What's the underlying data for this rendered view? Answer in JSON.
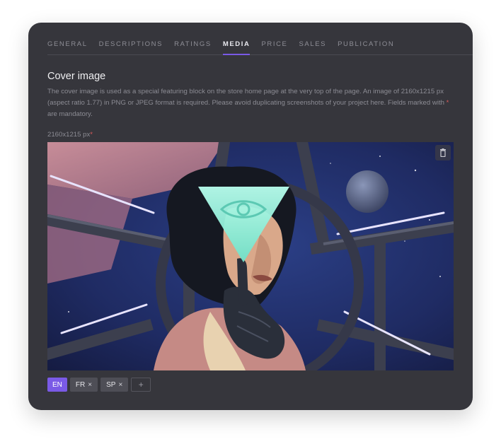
{
  "tabs": [
    {
      "label": "GENERAL"
    },
    {
      "label": "DESCRIPTIONS"
    },
    {
      "label": "RATINGS"
    },
    {
      "label": "MEDIA"
    },
    {
      "label": "PRICE"
    },
    {
      "label": "SALES"
    },
    {
      "label": "PUBLICATION"
    }
  ],
  "active_tab": "MEDIA",
  "cover": {
    "title": "Cover image",
    "description_before": "The cover image is used as a special featuring block on the store home page at the very top of the page. An image of 2160x1215 px (aspect ratio 1.77) in PNG or JPEG format is required. Please avoid duplicating screenshots of your project here. Fields marked with ",
    "required_mark": "*",
    "description_after": " are mandatory.",
    "size_label": "2160x1215 px",
    "size_required_mark": "*"
  },
  "languages": {
    "items": [
      {
        "code": "EN",
        "active": true,
        "removable": false
      },
      {
        "code": "FR",
        "active": false,
        "removable": true
      },
      {
        "code": "SP",
        "active": false,
        "removable": true
      }
    ],
    "remove_glyph": "×",
    "add_glyph": "+"
  },
  "colors": {
    "accent": "#7a5ae6",
    "card_bg": "#36363c",
    "required": "#d95a5a"
  },
  "icons": {
    "delete": "trash-icon",
    "remove": "close-icon",
    "add": "plus-icon"
  }
}
